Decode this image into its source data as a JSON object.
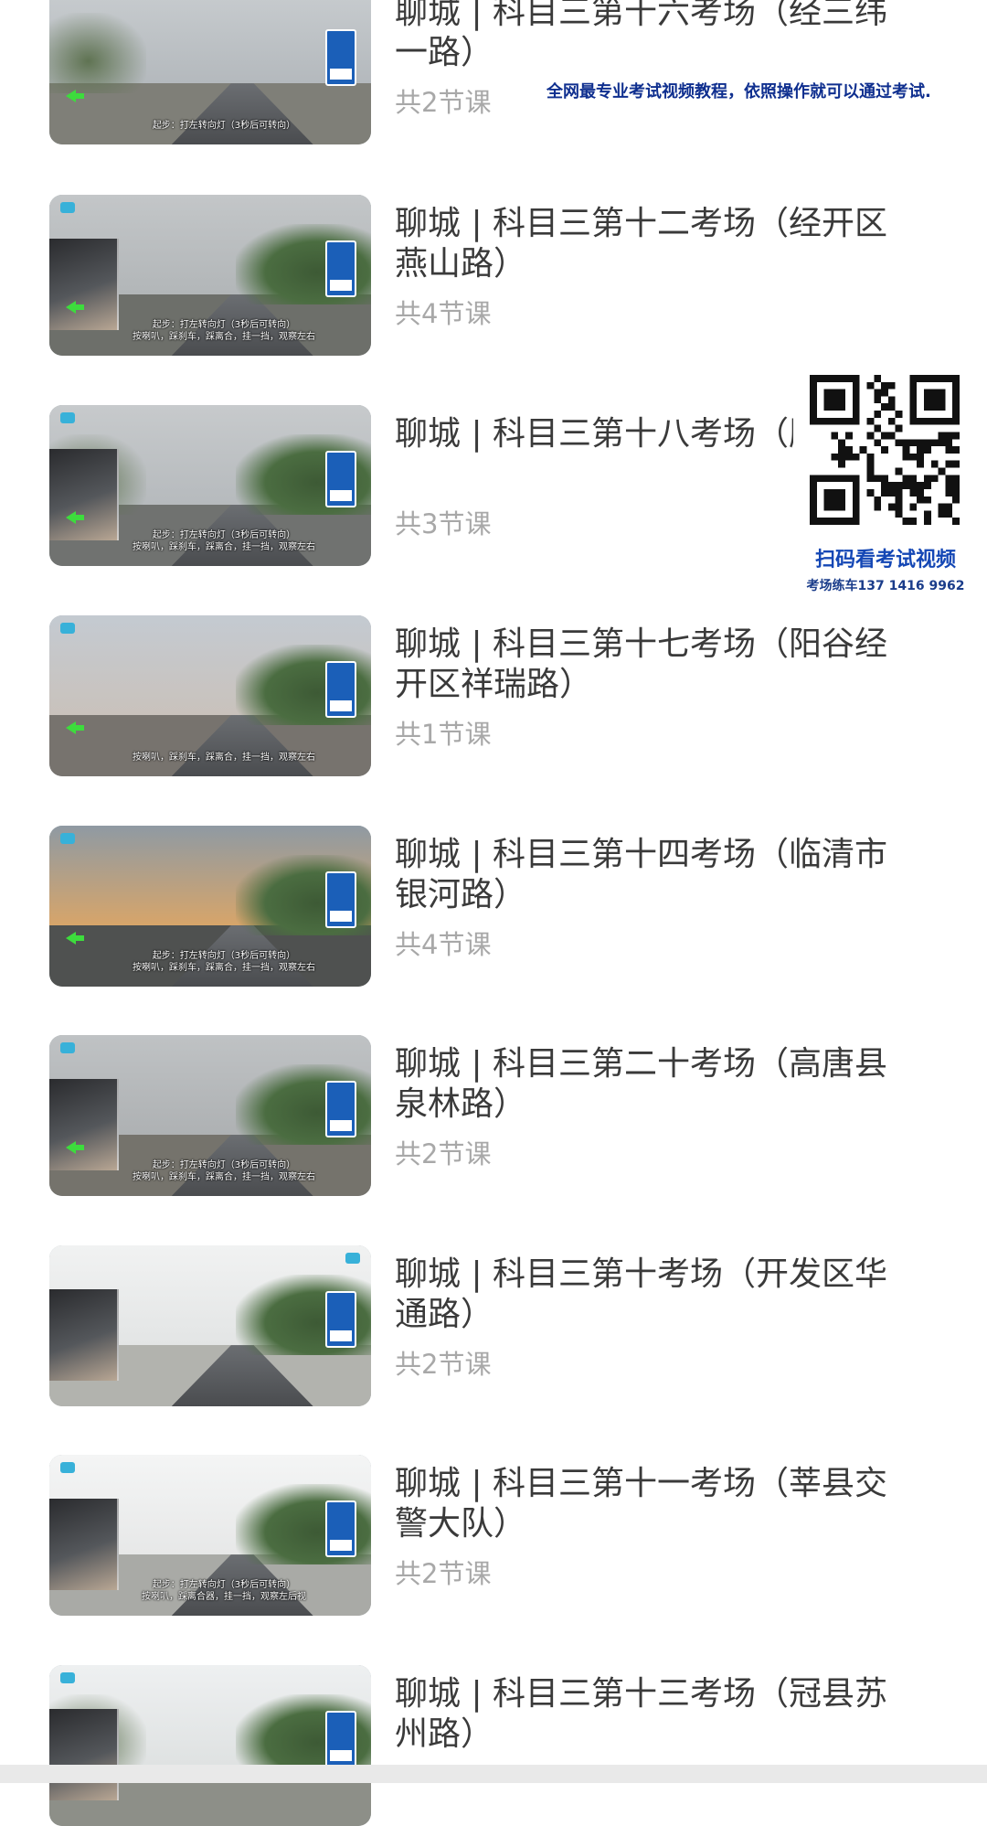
{
  "courses": [
    {
      "title": "聊城 | 科目三第十六考场（经三纬一路）",
      "count": "共2节课",
      "caption": [
        "起步：打左转向灯（3秒后可转向）",
        "",
        ""
      ]
    },
    {
      "title": "聊城 | 科目三第十二考场（经开区燕山路）",
      "count": "共4节课",
      "caption": [
        "起步：打左转向灯（3秒后可转向）",
        "按喇叭，踩刹车，踩离合，挂一挡，观察左右",
        ""
      ]
    },
    {
      "title": "聊城 | 科目三第十八考场（胶光路）",
      "count": "共3节课",
      "caption": [
        "起步：打左转向灯（3秒后可转向）",
        "按喇叭，踩刹车，踩离合，挂一挡，观察左右",
        ""
      ]
    },
    {
      "title": "聊城 | 科目三第十七考场（阳谷经开区祥瑞路）",
      "count": "共1节课",
      "caption": [
        "",
        "按喇叭，踩刹车，踩离合，挂一挡，观察左右",
        ""
      ]
    },
    {
      "title": "聊城 | 科目三第十四考场（临清市银河路）",
      "count": "共4节课",
      "caption": [
        "起步：打左转向灯（3秒后可转向）",
        "按喇叭，踩刹车，踩离合，挂一挡，观察左右",
        ""
      ]
    },
    {
      "title": "聊城 | 科目三第二十考场（高唐县泉林路）",
      "count": "共2节课",
      "caption": [
        "起步：打左转向灯（3秒后可转向）",
        "按喇叭，踩刹车，踩离合，挂一挡，观察左右",
        ""
      ]
    },
    {
      "title": "聊城 | 科目三第十考场（开发区华通路）",
      "count": "共2节课",
      "caption": [
        "",
        "",
        ""
      ]
    },
    {
      "title": "聊城 | 科目三第十一考场（莘县交警大队）",
      "count": "共2节课",
      "caption": [
        "起步：打左转向灯（3秒后可转向）",
        "按喇叭，踩离合器，挂一挡，观察左后视",
        ""
      ]
    },
    {
      "title": "聊城 | 科目三第十三考场（冠县苏州路）",
      "count": "",
      "caption": [
        "",
        "",
        ""
      ]
    }
  ],
  "promo": {
    "banner": "全网最专业考试视频教程，依照操作就可以通过考试.",
    "qr_caption": "扫码看考试视频",
    "phone": "考场练车137 1416 9962"
  },
  "colors": {
    "title": "#3a3a3a",
    "count": "#a8a8a8",
    "promo": "#0f2f8f",
    "qr_caption": "#1447b5"
  }
}
